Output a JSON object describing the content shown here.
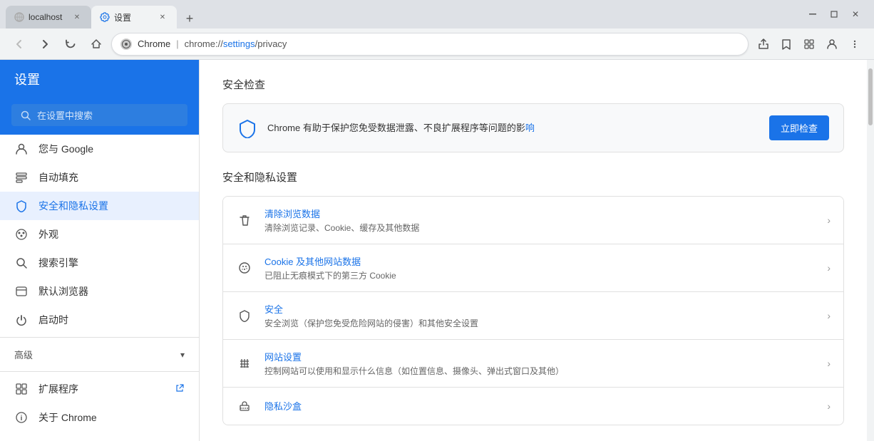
{
  "browser": {
    "tabs": [
      {
        "id": "tab1",
        "title": "localhost",
        "active": false,
        "icon": "globe"
      },
      {
        "id": "tab2",
        "title": "设置",
        "active": true,
        "icon": "gear"
      }
    ],
    "address": {
      "scheme": "Chrome",
      "separator": " | ",
      "url": "chrome://settings/privacy",
      "url_highlight_start": "chrome://",
      "url_path": "settings",
      "url_end": "/privacy"
    },
    "window_controls": {
      "minimize": "─",
      "restore": "□",
      "close": "✕"
    }
  },
  "sidebar": {
    "header_title": "设置",
    "search_placeholder": "在设置中搜索",
    "items": [
      {
        "id": "google",
        "label": "您与 Google",
        "icon": "person"
      },
      {
        "id": "autofill",
        "label": "自动填充",
        "icon": "fill"
      },
      {
        "id": "privacy",
        "label": "安全和隐私设置",
        "icon": "shield",
        "active": true
      },
      {
        "id": "appearance",
        "label": "外观",
        "icon": "palette"
      },
      {
        "id": "search",
        "label": "搜索引擎",
        "icon": "search"
      },
      {
        "id": "browser",
        "label": "默认浏览器",
        "icon": "browser"
      },
      {
        "id": "startup",
        "label": "启动时",
        "icon": "power"
      }
    ],
    "advanced_section": "高级",
    "extensions_label": "扩展程序",
    "about_label": "关于 Chrome"
  },
  "content": {
    "safety_check_title": "安全检查",
    "safety_check_description": "Chrome 有助于保护您免受数据泄露、不良扩展程序等问题的影",
    "safety_check_link": "响",
    "safety_check_button": "立即检查",
    "privacy_section_title": "安全和隐私设置",
    "settings_items": [
      {
        "id": "clear-browsing",
        "icon": "trash",
        "title": "清除浏览数据",
        "subtitle": "清除浏览记录、Cookie、缓存及其他数据"
      },
      {
        "id": "cookies",
        "icon": "cookie",
        "title": "Cookie 及其他网站数据",
        "subtitle": "已阻止无痕模式下的第三方 Cookie"
      },
      {
        "id": "security",
        "icon": "shield-sm",
        "title": "安全",
        "subtitle": "安全浏览（保护您免受危险网站的侵害）和其他安全设置"
      },
      {
        "id": "site-settings",
        "icon": "grid",
        "title": "网站设置",
        "subtitle": "控制网站可以使用和显示什么信息（如位置信息、摄像头、弹出式窗口及其他）"
      },
      {
        "id": "privacy-sandbox",
        "icon": "sandbox",
        "title": "隐私沙盒",
        "subtitle": ""
      }
    ]
  }
}
